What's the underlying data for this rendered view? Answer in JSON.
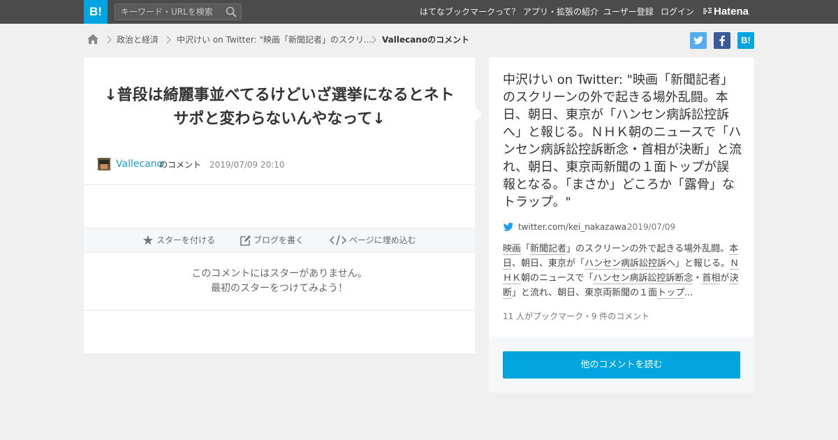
{
  "header": {
    "logo": "B!",
    "search_placeholder": "キーワード・URLを検索",
    "nav": [
      "はてなブックマークって？",
      "アプリ・拡張の紹介",
      "ユーザー登録",
      "ログイン"
    ],
    "brand": "Hatena"
  },
  "breadcrumb": {
    "items": [
      "政治と経済",
      "中沢けい on Twitter: \"映画「新聞記者」のスクリ...",
      "Vallecanoのコメント"
    ]
  },
  "share": {
    "twitter_icon": "twitter-icon",
    "facebook_icon": "facebook-icon",
    "hatena_label": "B!"
  },
  "comment": {
    "text": "↓普段は綺麗事並べてるけどいざ選挙になるとネトサポと変わらないんやなって↓",
    "user": "Vallecano",
    "user_suffix": "のコメント",
    "date": "2019/07/09 20:10",
    "actions": {
      "star": "スターを付ける",
      "blog": "ブログを書く",
      "embed": "ページに埋め込む"
    },
    "no_star_line1": "このコメントにはスターがありません。",
    "no_star_line2": "最初のスターをつけてみよう！"
  },
  "entry": {
    "title": "中沢けい on Twitter: \"映画「新聞記者」のスクリーンの外で起きる場外乱闘。本日、朝日、東京が「ハンセン病訴訟控訴へ」と報じる。ＮＨＫ朝のニュースで「ハンセン病訴訟控訴断念・首相が決断」と流れ、朝日、東京両新聞の１面トップが誤報となる。「まさか」どころか「露骨」なトラップ。\"",
    "domain": "twitter.com/kei_nakazawa",
    "date": "2019/07/09",
    "summary_parts": [
      {
        "t": "映画",
        "u": true
      },
      {
        "t": "「",
        "u": false
      },
      {
        "t": "新聞記者",
        "u": true
      },
      {
        "t": "」のスクリーンの外で起きる場外乱闘。",
        "u": false
      },
      {
        "t": "本日",
        "u": true
      },
      {
        "t": "、朝日、東京が「",
        "u": false
      },
      {
        "t": "ハンセン病訴訟控訴",
        "u": true
      },
      {
        "t": "へ」と報じる。",
        "u": false
      },
      {
        "t": "ＮＨＫ",
        "u": true
      },
      {
        "t": "朝のニュースで「",
        "u": false
      },
      {
        "t": "ハンセン病訴訟控訴断念",
        "u": true
      },
      {
        "t": "・",
        "u": false
      },
      {
        "t": "首相",
        "u": true
      },
      {
        "t": "が",
        "u": false
      },
      {
        "t": "決断",
        "u": true
      },
      {
        "t": "」と流れ、朝日、東京両新聞の１面",
        "u": false
      },
      {
        "t": "トップ",
        "u": true
      },
      {
        "t": "...",
        "u": false
      }
    ],
    "counts": "11 人がブックマーク・9 件のコメント",
    "more_button": "他のコメントを読む"
  },
  "colors": {
    "accent": "#00a4de",
    "header_bg": "#4b4b4b",
    "user_link": "#1a9ec9",
    "twitter": "#1da1f2",
    "facebook": "#3b5998"
  }
}
